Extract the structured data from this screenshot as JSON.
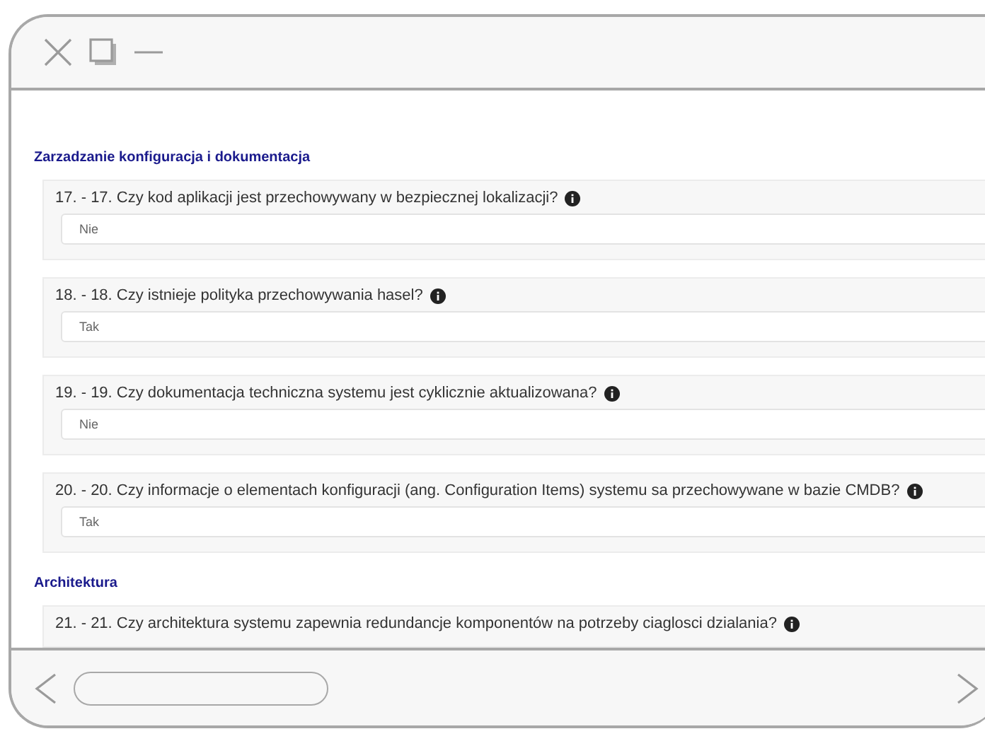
{
  "sections": [
    {
      "title": "Zarzadzanie konfiguracja i dokumentacja",
      "questions": [
        {
          "label": "17. - 17. Czy kod aplikacji jest przechowywany w bezpiecznej lokalizacji?",
          "answer": "Nie"
        },
        {
          "label": "18. - 18. Czy istnieje polityka przechowywania hasel?",
          "answer": "Tak"
        },
        {
          "label": "19. - 19. Czy dokumentacja techniczna systemu jest cyklicznie aktualizowana?",
          "answer": "Nie"
        },
        {
          "label": "20. - 20. Czy informacje o elementach konfiguracji (ang. Configuration Items) systemu sa przechowywane w bazie CMDB?",
          "answer": "Tak"
        }
      ]
    },
    {
      "title": "Architektura",
      "questions": [
        {
          "label": "21. - 21. Czy architektura systemu zapewnia redundancje komponentów na potrzeby ciaglosci dzialania?"
        }
      ]
    }
  ]
}
